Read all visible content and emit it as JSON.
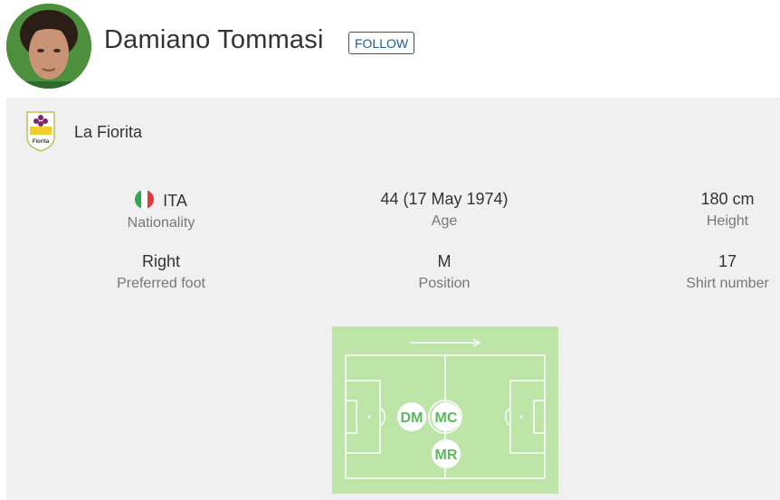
{
  "player": {
    "name": "Damiano Tommasi",
    "follow_label": "FOLLOW"
  },
  "club": {
    "name": "La Fiorita",
    "logo_text": "Fiorita"
  },
  "details": {
    "nationality": {
      "value": "ITA",
      "label": "Nationality",
      "flag": "italy-flag"
    },
    "age": {
      "value": "44 (17 May 1974)",
      "label": "Age"
    },
    "height": {
      "value": "180 cm",
      "label": "Height"
    },
    "foot": {
      "value": "Right",
      "label": "Preferred foot"
    },
    "position": {
      "value": "M",
      "label": "Position"
    },
    "shirt": {
      "value": "17",
      "label": "Shirt number"
    }
  },
  "positions": [
    "DM",
    "MC",
    "MR"
  ],
  "colors": {
    "accent": "#1f5c8b",
    "pitch": "#bde5a8",
    "position_text": "#5cb85c",
    "card_bg": "#f0f0f0"
  }
}
